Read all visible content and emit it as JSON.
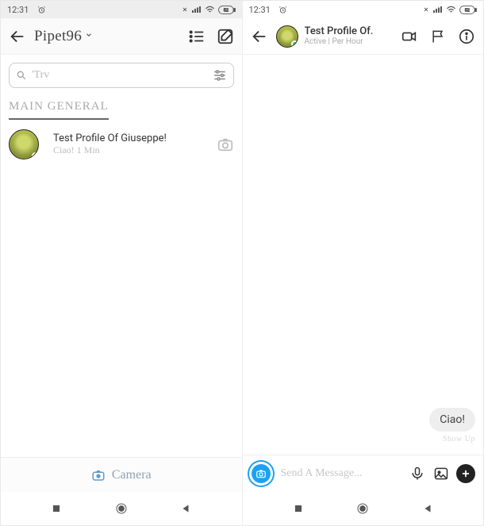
{
  "left": {
    "status": {
      "time": "12:31",
      "icons": "bt signal wifi battery"
    },
    "header": {
      "username": "Pipet96"
    },
    "search": {
      "placeholder": "'Trv"
    },
    "tabs": {
      "main": "MAIN GENERAL"
    },
    "chat_item": {
      "name": "Test Profile Of Giuseppe!",
      "preview": "Ciao! 1 Min"
    },
    "camera_label": "Camera"
  },
  "right": {
    "status": {
      "time": "12:31"
    },
    "header": {
      "name": "Test Profile Of.",
      "status": "Active | Per Hour"
    },
    "bubble": "Ciao!",
    "show_up": "Show Up",
    "composer_placeholder": "Send A Message..."
  }
}
